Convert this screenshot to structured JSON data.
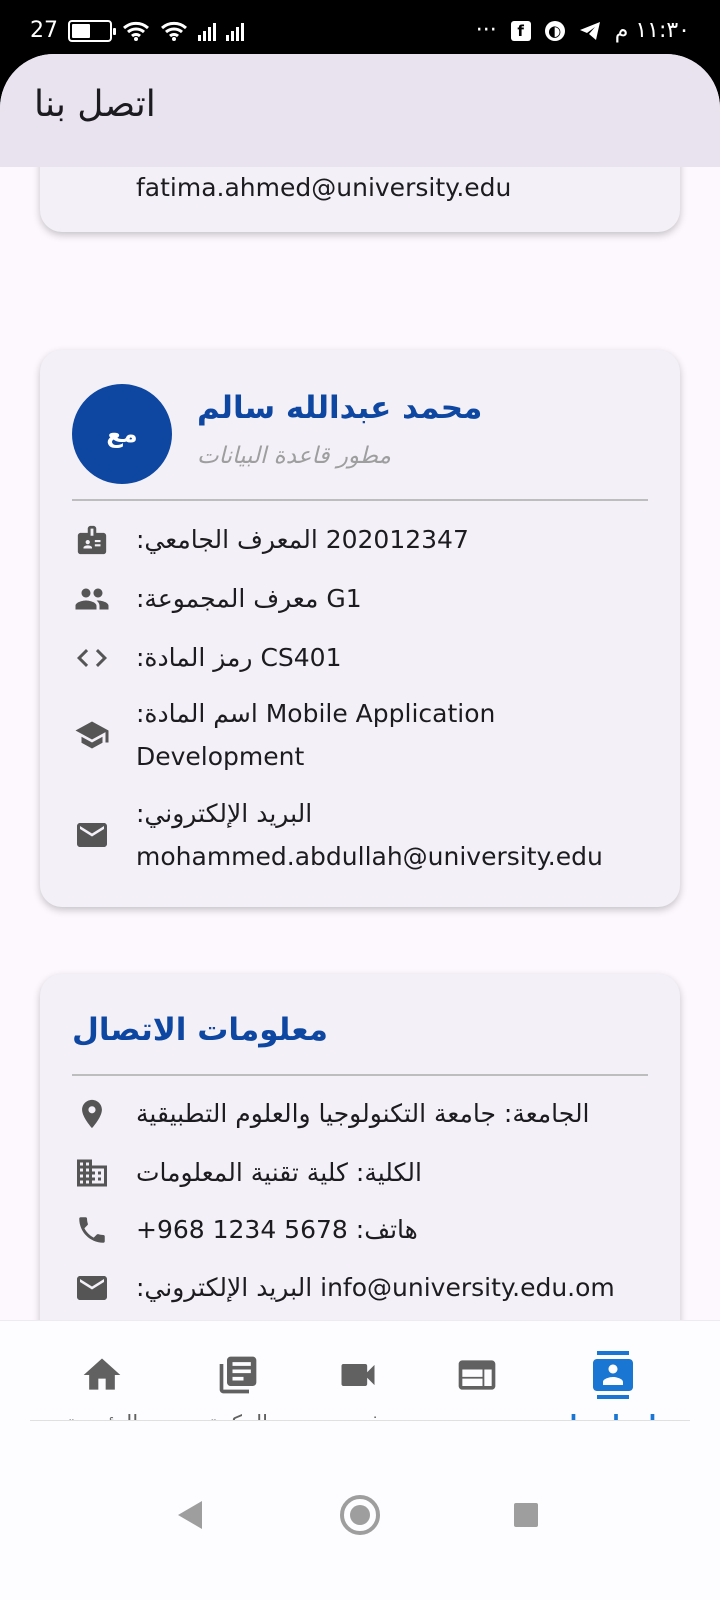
{
  "status_bar": {
    "battery_text": "27",
    "time": "١١:٣٠ م",
    "overflow": "···",
    "icons": [
      "battery-charging-icon",
      "wifi-icon",
      "signal-icon",
      "facebook-icon",
      "app-icon",
      "telegram-icon"
    ]
  },
  "app_bar": {
    "title": "اتصل بنا"
  },
  "previous_card": {
    "email_tail": "fatima.ahmed@university.edu"
  },
  "member_card": {
    "avatar_initials": "مع",
    "name": "محمد عبدالله سالم",
    "role": "مطور قاعدة البيانات",
    "rows": [
      {
        "icon": "badge-icon",
        "label": "المعرف الجامعي:",
        "value": "202012347"
      },
      {
        "icon": "group-icon",
        "label": "معرف المجموعة:",
        "value": "G1"
      },
      {
        "icon": "code-icon",
        "label": "رمز المادة:",
        "value": "CS401"
      },
      {
        "icon": "school-icon",
        "label": "اسم المادة:",
        "value": "Mobile Application Development"
      },
      {
        "icon": "email-icon",
        "label": "البريد الإلكتروني:",
        "value": "mohammed.abdullah@university.edu"
      }
    ]
  },
  "contact_card": {
    "title": "معلومات الاتصال",
    "rows": [
      {
        "icon": "location-icon",
        "label": "الجامعة:",
        "value": "جامعة التكنولوجيا والعلوم التطبيقية"
      },
      {
        "icon": "building-icon",
        "label": "الكلية:",
        "value": "كلية تقنية المعلومات"
      },
      {
        "icon": "phone-icon",
        "label": "هاتف:",
        "value": "+968 1234 5678"
      },
      {
        "icon": "email-icon",
        "label": "البريد الإلكتروني:",
        "value": "info@university.edu.om"
      }
    ]
  },
  "bottom_nav": {
    "items": [
      {
        "label": "الرئيسية",
        "icon": "home-icon",
        "active": false
      },
      {
        "label": "المكتبة",
        "icon": "library-icon",
        "active": false
      },
      {
        "label": "فيديو",
        "icon": "video-icon",
        "active": false
      },
      {
        "label": "ويب",
        "icon": "web-icon",
        "active": false
      },
      {
        "label": "اتصل بنا",
        "icon": "contact-icon",
        "active": true
      }
    ]
  },
  "colors": {
    "primary": "#0d47a1",
    "active_nav": "#1976d2",
    "app_bar_bg": "#e9e3f0",
    "card_bg": "#f4f0f7",
    "green_button": "#4caf50"
  }
}
